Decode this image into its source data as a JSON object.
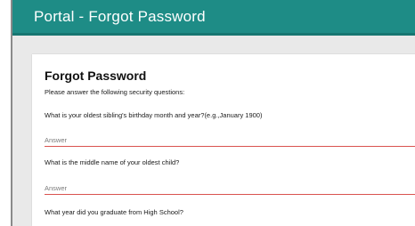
{
  "header": {
    "title": "Portal - Forgot Password"
  },
  "form": {
    "title": "Forgot Password",
    "instructions": "Please answer the following security questions:",
    "questions": [
      {
        "label": "What is your oldest sibling's birthday month and year?(e.g.,January 1900)",
        "placeholder": "Answer",
        "value": ""
      },
      {
        "label": "What is the middle name of your oldest child?",
        "placeholder": "Answer",
        "value": ""
      },
      {
        "label": "What year did you graduate from High School?"
      }
    ]
  },
  "colors": {
    "header": "#1e8c86",
    "input_underline": "#d9534f",
    "page_background": "#e9e9e9"
  }
}
